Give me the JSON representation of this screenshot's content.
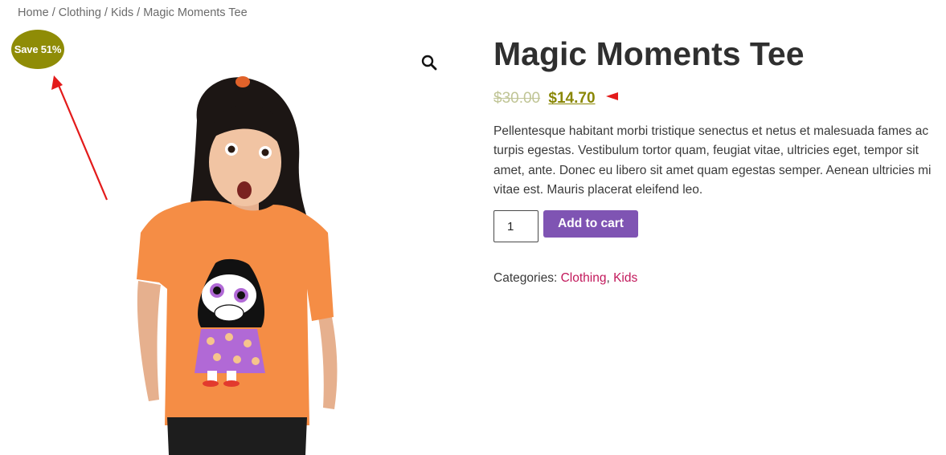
{
  "breadcrumb": {
    "items": [
      "Home",
      "Clothing",
      "Kids",
      "Magic Moments Tee"
    ],
    "separator": "/"
  },
  "badge": {
    "label": "Save 51%",
    "color": "#8f8c06"
  },
  "product": {
    "title": "Magic Moments Tee",
    "regular_price": "$30.00",
    "sale_price": "$14.70",
    "description": "Pellentesque habitant morbi tristique senectus et netus et malesuada fames ac turpis egestas. Vestibulum tortor quam, feugiat vitae, ultricies eget, tempor sit amet, ante. Donec eu libero sit amet quam egestas semper. Aenean ultricies mi vitae est. Mauris placerat eleifend leo.",
    "quantity": "1",
    "add_to_cart_label": "Add to cart",
    "categories_label": "Categories:",
    "categories": [
      "Clothing",
      "Kids"
    ]
  },
  "icons": {
    "zoom": "magnifier-icon"
  },
  "colors": {
    "button": "#7f54b3",
    "sale_price": "#8a8705",
    "category_link": "#c2185b",
    "annotation": "#e31b1b"
  }
}
